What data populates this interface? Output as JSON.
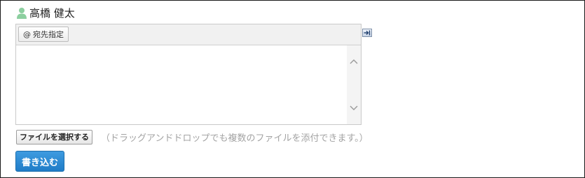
{
  "user": {
    "name": "高橋 健太",
    "icon": "user-icon",
    "icon_color": "#8ccf9f"
  },
  "editor": {
    "mention_button": {
      "symbol": "@",
      "label": "宛先指定"
    },
    "body_value": "",
    "expand_icon": "expand-arrow-icon",
    "scroll_up_icon": "chevron-up-icon",
    "scroll_down_icon": "chevron-down-icon"
  },
  "attachments": {
    "button_label": "ファイルを選択する",
    "hint": "（ドラッグアンドドロップでも複数のファイルを添付できます。）"
  },
  "submit": {
    "label": "書き込む",
    "color": "#2587d1"
  }
}
